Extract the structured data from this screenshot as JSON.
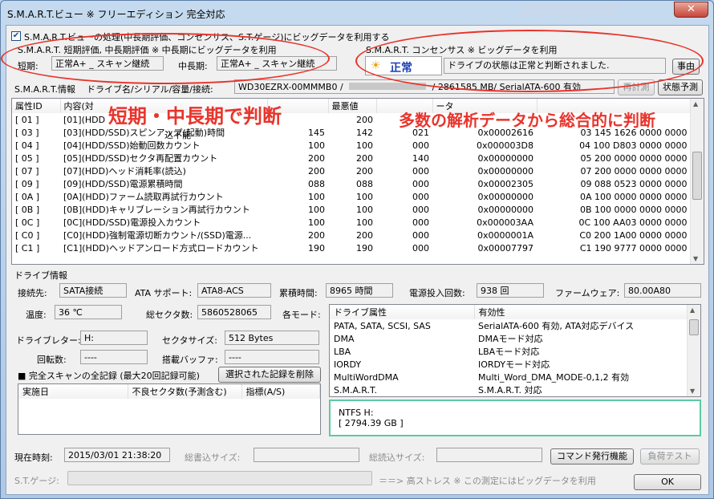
{
  "window": {
    "title": "S.M.A.R.T.ビュー ※ フリーエディション 完全対応",
    "close_symbol": "✕"
  },
  "top": {
    "use_bigdata_label": "S.M.A.R.T.ビューの処理(中長期評価、コンセンサス、S.T.ゲージ)にビッグデータを利用する",
    "use_bigdata_checked": true,
    "short_term_group": "S.M.A.R.T. 短期評価, 中長期評価 ※ 中長期にビッグデータを利用",
    "short_label": "短期:",
    "short_value": "正常A+ _ スキャン継続",
    "mid_label": "中長期:",
    "mid_value": "正常A+ _ スキャン継続",
    "consensus_group": "S.M.A.R.T. コンセンサス ※ ビッグデータを利用",
    "consensus_status": "正常",
    "consensus_message": "ドライブの状態は正常と判断されました.",
    "consensus_button": "事由"
  },
  "smart_info": {
    "label": "S.M.A.R.T.情報",
    "drive_label": "ドライブ名/シリアル/容量/接続:",
    "drive_value_model": "WD30EZRX-00MMMB0 /",
    "drive_value_rest": "/ 2861585 MB/ SerialATA-600 有効",
    "recalc_button": "再計測",
    "predict_button": "状態予測"
  },
  "smart_table": {
    "headers": [
      "属性ID",
      "内容(対",
      "",
      "最悪値",
      "",
      "ータ",
      ""
    ],
    "rows": [
      {
        "id": "[ 01 ]",
        "name": "[01](HDD",
        "cur": "",
        "worst": "200",
        "thr": "",
        "raw": "",
        "hex": ""
      },
      {
        "id": "[ 03 ]",
        "name": "[03](HDD/SSD)スピンアップ(起動)時間",
        "cur": "145",
        "worst": "142",
        "thr": "021",
        "raw": "0x00002616",
        "hex": "03 145  1626 0000 0000"
      },
      {
        "id": "[ 04 ]",
        "name": "[04](HDD/SSD)始動回数カウント",
        "cur": "100",
        "worst": "100",
        "thr": "000",
        "raw": "0x000003D8",
        "hex": "04 100  D803 0000 0000"
      },
      {
        "id": "[ 05 ]",
        "name": "[05](HDD/SSD)セクタ再配置カウント",
        "cur": "200",
        "worst": "200",
        "thr": "140",
        "raw": "0x00000000",
        "hex": "05 200  0000 0000 0000"
      },
      {
        "id": "[ 07 ]",
        "name": "[07](HDD)ヘッド消耗率(読込)",
        "cur": "200",
        "worst": "200",
        "thr": "000",
        "raw": "0x00000000",
        "hex": "07 200  0000 0000 0000"
      },
      {
        "id": "[ 09 ]",
        "name": "[09](HDD/SSD)電源累積時間",
        "cur": "088",
        "worst": "088",
        "thr": "000",
        "raw": "0x00002305",
        "hex": "09 088  0523 0000 0000"
      },
      {
        "id": "[ 0A ]",
        "name": "[0A](HDD)ファーム読取再試行カウント",
        "cur": "100",
        "worst": "100",
        "thr": "000",
        "raw": "0x00000000",
        "hex": "0A 100  0000 0000 0000"
      },
      {
        "id": "[ 0B ]",
        "name": "[0B](HDD)キャリブレーション再試行カウント",
        "cur": "100",
        "worst": "100",
        "thr": "000",
        "raw": "0x00000000",
        "hex": "0B 100  0000 0000 0000"
      },
      {
        "id": "[ 0C ]",
        "name": "[0C](HDD/SSD)電源投入カウント",
        "cur": "100",
        "worst": "100",
        "thr": "000",
        "raw": "0x000003AA",
        "hex": "0C 100  AA03 0000 0000"
      },
      {
        "id": "[ C0 ]",
        "name": "[C0](HDD)強制電源切断カウント/(SSD)電源...",
        "cur": "200",
        "worst": "200",
        "thr": "000",
        "raw": "0x0000001A",
        "hex": "C0 200  1A00 0000 0000"
      },
      {
        "id": "[ C1 ]",
        "name": "[C1](HDD)ヘッドアンロード方式ロードカウント",
        "cur": "190",
        "worst": "190",
        "thr": "000",
        "raw": "0x00007797",
        "hex": "C1 190  9777 0000 0000"
      }
    ],
    "overlay_fragment": "込不能"
  },
  "callouts": {
    "left": "短期・中長期で判断",
    "right": "多数の解析データから総合的に判断"
  },
  "drive_info": {
    "group": "ドライブ情報",
    "conn_label": "接続先:",
    "conn_value": "SATA接続",
    "ata_label": "ATA サポート:",
    "ata_value": "ATA8-ACS",
    "hours_label": "累積時間:",
    "hours_value": "8965 時間",
    "power_label": "電源投入回数:",
    "power_value": "938 回",
    "fw_label": "ファームウェア:",
    "fw_value": "80.00A80",
    "temp_label": "温度:",
    "temp_value": "36 ℃",
    "sectors_label": "総セクタ数:",
    "sectors_value": "5860528065",
    "modes_label": "各モード:",
    "letter_label": "ドライブレター:",
    "letter_value": "H:",
    "sector_size_label": "セクタサイズ:",
    "sector_size_value": "512 Bytes",
    "rpm_label": "回転数:",
    "rpm_value": "----",
    "buffer_label": "搭載バッファ:",
    "buffer_value": "----"
  },
  "attr_table": {
    "headers": [
      "ドライブ属性",
      "有効性"
    ],
    "rows": [
      {
        "attr": "PATA, SATA, SCSI, SAS",
        "val": "SerialATA-600 有効, ATA対応デバイス"
      },
      {
        "attr": "DMA",
        "val": "DMAモード対応"
      },
      {
        "attr": "LBA",
        "val": "LBAモード対応"
      },
      {
        "attr": "IORDY",
        "val": "IORDYモード対応"
      },
      {
        "attr": "MultiWordDMA",
        "val": "Multi_Word_DMA_MODE-0,1,2 有効"
      },
      {
        "attr": "S.M.A.R.T.",
        "val": "S.M.A.R.T. 対応"
      }
    ]
  },
  "scan_records": {
    "title": "■ 完全スキャンの全記録 (最大20回記録可能)",
    "delete_button": "選択された記録を削除",
    "headers": [
      "実施日",
      "不良セクタ数(予測含む)",
      "指標(A/S)"
    ]
  },
  "volume": {
    "line1": "NTFS H:",
    "line2": "[ 2794.39 GB ]"
  },
  "bottom": {
    "time_label": "現在時刻:",
    "time_value": "2015/03/01 21:38:20",
    "write_label": "総書込サイズ:",
    "read_label": "総読込サイズ:",
    "command_button": "コマンド発行機能",
    "load_button": "負荷テスト",
    "gauge_label": "S.T.ゲージ:",
    "gauge_note": "＝＝> 高ストレス ※ この測定にはビッグデータを利用",
    "ok_button": "OK"
  }
}
